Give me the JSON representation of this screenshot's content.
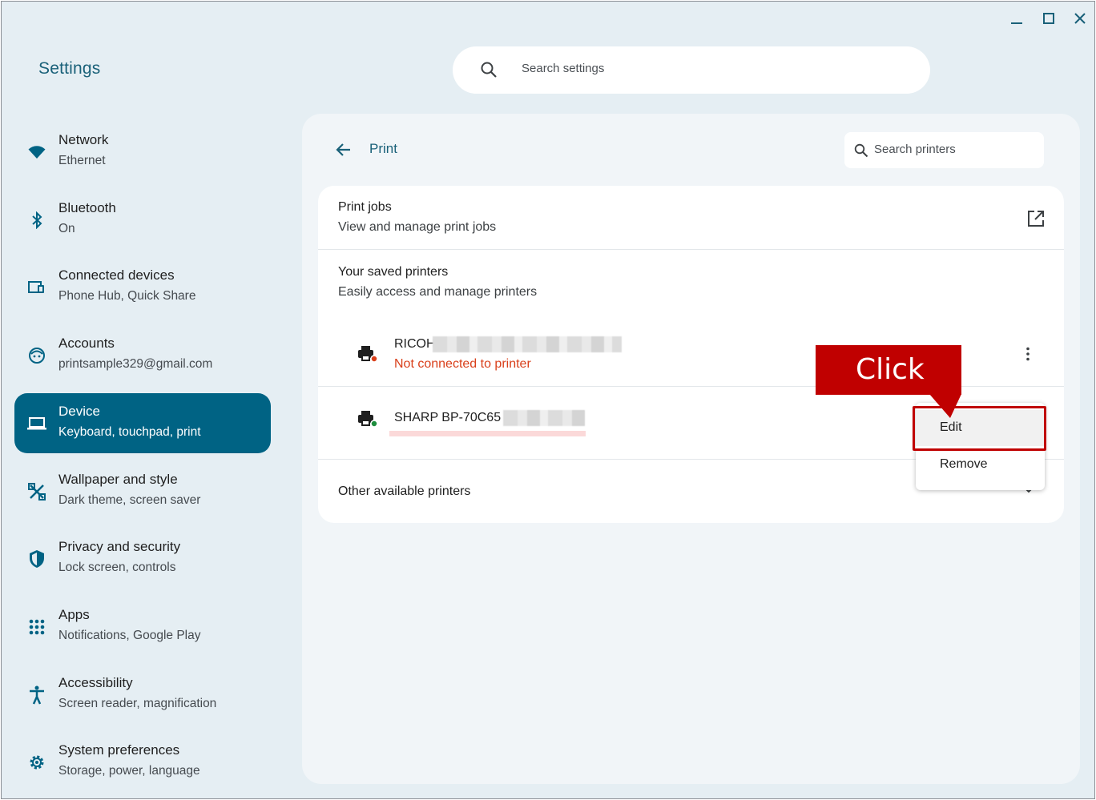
{
  "window": {
    "controls": [
      "minimize-icon",
      "maximize-icon",
      "close-icon"
    ]
  },
  "app_title": "Settings",
  "search": {
    "placeholder": "Search settings",
    "icon": "search-icon"
  },
  "sidebar": {
    "items": [
      {
        "title": "Network",
        "subtitle": "Ethernet",
        "icon": "wifi-icon",
        "active": false
      },
      {
        "title": "Bluetooth",
        "subtitle": "On",
        "icon": "bluetooth-icon",
        "active": false
      },
      {
        "title": "Connected devices",
        "subtitle": "Phone Hub, Quick Share",
        "icon": "connected-devices-icon",
        "active": false
      },
      {
        "title": "Accounts",
        "subtitle": "printsample329@gmail.com",
        "icon": "account-icon",
        "active": false
      },
      {
        "title": "Device",
        "subtitle": "Keyboard, touchpad, print",
        "icon": "laptop-icon",
        "active": true
      },
      {
        "title": "Wallpaper and style",
        "subtitle": "Dark theme, screen saver",
        "icon": "palette-icon",
        "active": false
      },
      {
        "title": "Privacy and security",
        "subtitle": "Lock screen, controls",
        "icon": "shield-icon",
        "active": false
      },
      {
        "title": "Apps",
        "subtitle": "Notifications, Google Play",
        "icon": "apps-grid-icon",
        "active": false
      },
      {
        "title": "Accessibility",
        "subtitle": "Screen reader, magnification",
        "icon": "accessibility-icon",
        "active": false
      },
      {
        "title": "System preferences",
        "subtitle": "Storage, power, language",
        "icon": "gear-icon",
        "active": false
      }
    ]
  },
  "page": {
    "title": "Print",
    "printer_search_placeholder": "Search printers"
  },
  "print_jobs": {
    "title": "Print jobs",
    "subtitle": "View and manage print jobs"
  },
  "saved_printers": {
    "title": "Your saved printers",
    "subtitle": "Easily access and manage printers",
    "printers": [
      {
        "name": "RICOH",
        "status": "Not connected to printer",
        "status_color": "#d93f1a"
      },
      {
        "name": "SHARP BP-70C65",
        "status": "",
        "status_color": "#1e8e3e"
      }
    ]
  },
  "other_printers": {
    "title": "Other available printers"
  },
  "context_menu": {
    "items": [
      "Edit",
      "Remove"
    ]
  },
  "annotation": {
    "label": "Click",
    "color": "#c00000"
  },
  "colors": {
    "accent": "#006384",
    "title_teal": "#1a6179",
    "background": "#e5eef3",
    "error": "#d93f1a"
  }
}
